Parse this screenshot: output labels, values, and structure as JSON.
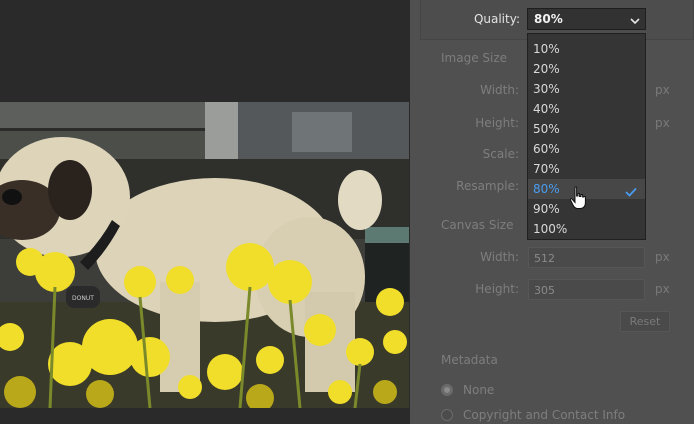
{
  "export": {
    "quality_label": "Quality:",
    "quality_value": "80%",
    "quality_options": [
      "10%",
      "20%",
      "30%",
      "40%",
      "50%",
      "60%",
      "70%",
      "80%",
      "90%",
      "100%"
    ],
    "selected_option": "80%"
  },
  "image_size": {
    "title": "Image Size",
    "width_label": "Width:",
    "height_label": "Height:",
    "scale_label": "Scale:",
    "resample_label": "Resample:",
    "width_unit": "px",
    "height_unit": "px"
  },
  "canvas_size": {
    "title": "Canvas Size",
    "width_label": "Width:",
    "width_value": "512",
    "width_unit": "px",
    "height_label": "Height:",
    "height_value": "305",
    "height_unit": "px",
    "reset_label": "Reset"
  },
  "metadata": {
    "title": "Metadata",
    "option_none": "None",
    "option_copyright": "Copyright and Contact Info"
  },
  "preview": {
    "dog_tag_text": "DONUT"
  },
  "colors": {
    "accent": "#4a9cf0",
    "panel_bg": "#505050",
    "app_bg": "#2a2a2a"
  }
}
